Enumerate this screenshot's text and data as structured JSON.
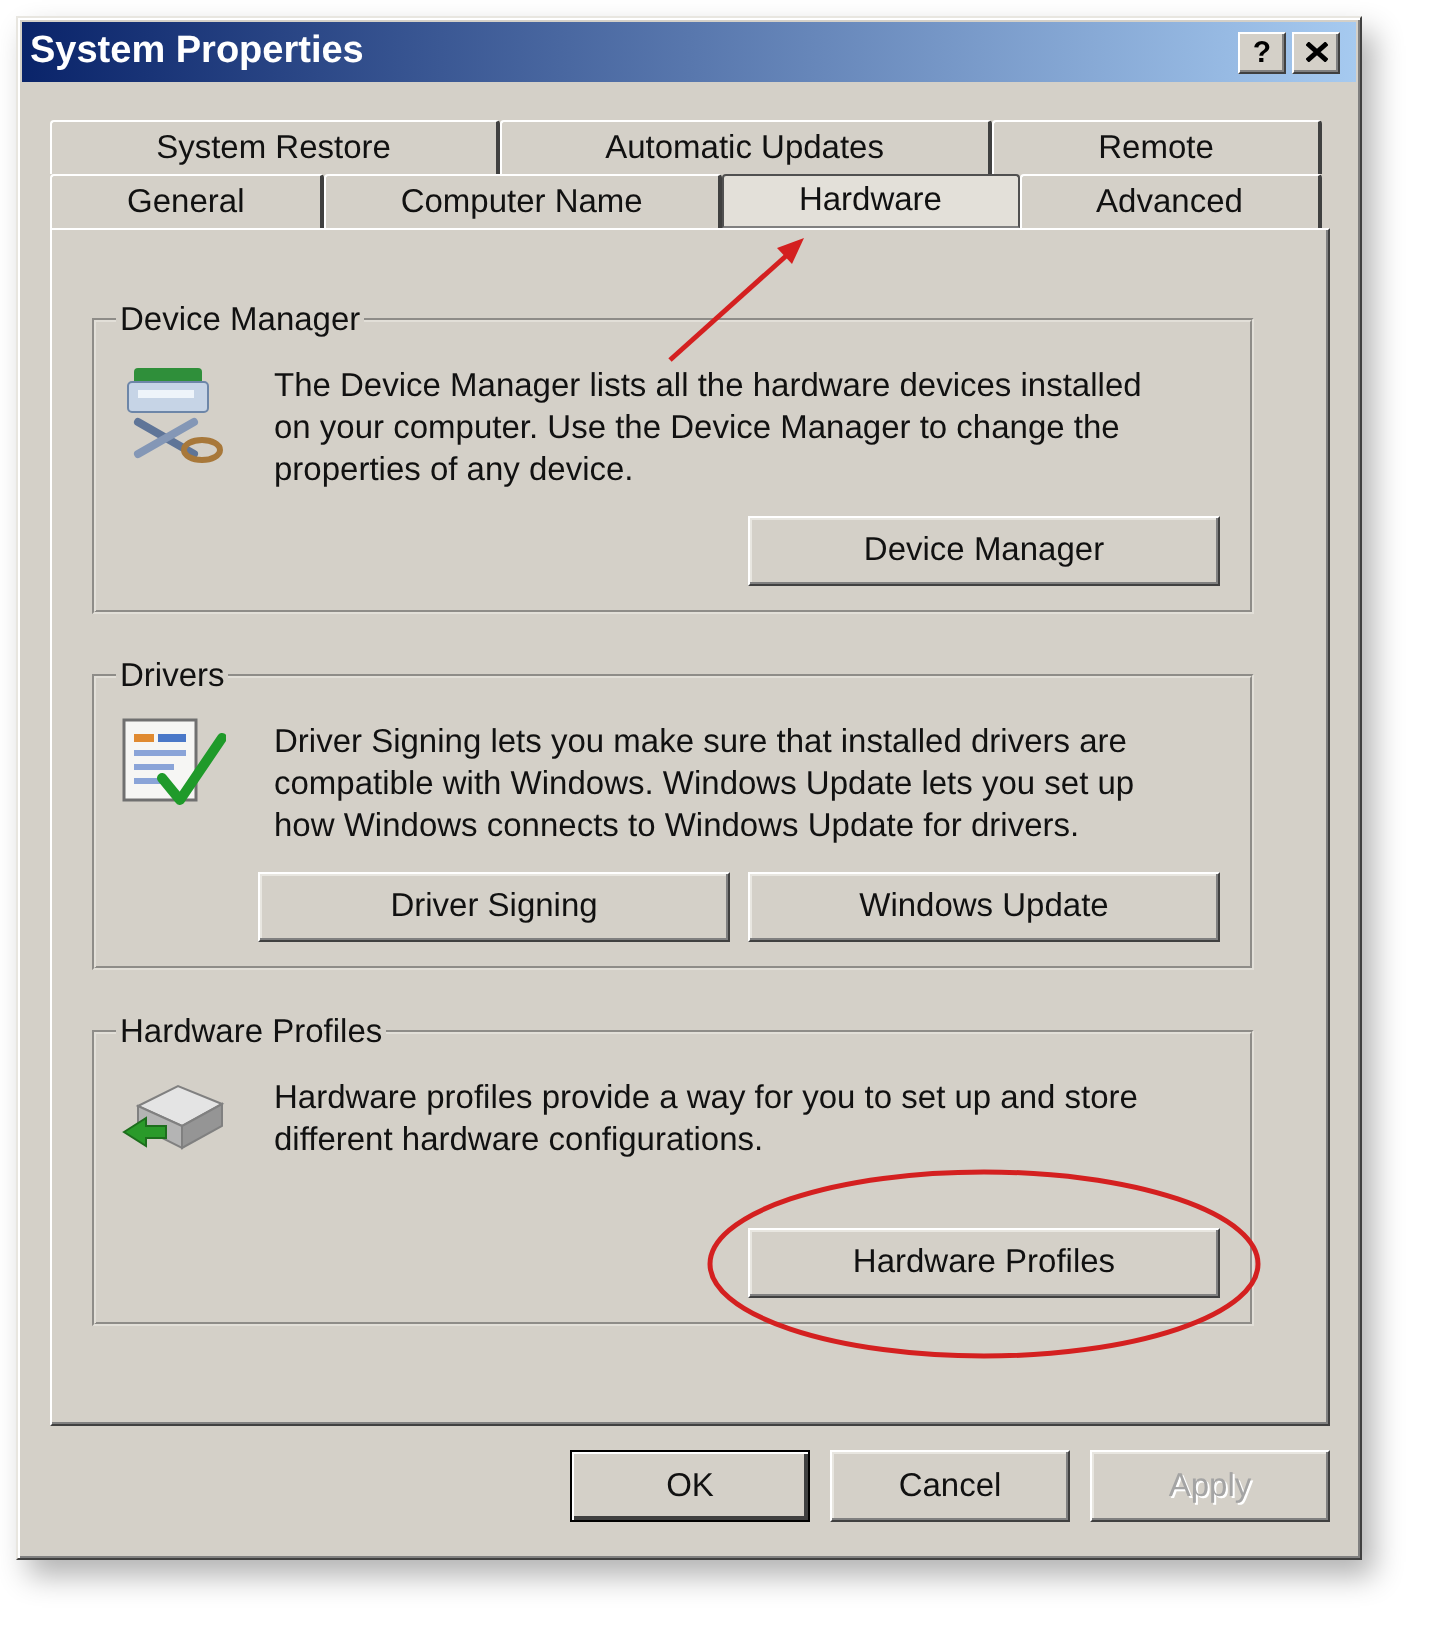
{
  "window": {
    "title": "System Properties",
    "help_button": "?"
  },
  "tab_rows": [
    {
      "tabs": [
        {
          "label": "System Restore",
          "selected": false,
          "arrow": false
        },
        {
          "label": "Automatic Updates",
          "selected": false,
          "arrow": false
        },
        {
          "label": "Remote",
          "selected": false,
          "arrow": false
        }
      ]
    },
    {
      "tabs": [
        {
          "label": "General",
          "selected": false,
          "arrow": false
        },
        {
          "label": "Computer Name",
          "selected": false,
          "arrow": false
        },
        {
          "label": "Hardware",
          "selected": true,
          "arrow": true
        },
        {
          "label": "Advanced",
          "selected": false,
          "arrow": false
        }
      ]
    }
  ],
  "groups": [
    {
      "title": "Device Manager",
      "description": "The Device Manager lists all the hardware devices installed on your computer. Use the Device Manager to change the properties of any device.",
      "buttons": [
        {
          "label": "Device Manager",
          "circled": false
        }
      ]
    },
    {
      "title": "Drivers",
      "description": "Driver Signing lets you make sure that installed drivers are compatible with Windows. Windows Update lets you set up how Windows connects to Windows Update for drivers.",
      "buttons": [
        {
          "label": "Driver Signing",
          "circled": false
        },
        {
          "label": "Windows Update",
          "circled": false
        }
      ]
    },
    {
      "title": "Hardware Profiles",
      "description": "Hardware profiles provide a way for you to set up and store different hardware configurations.",
      "buttons": [
        {
          "label": "Hardware Profiles",
          "circled": true
        }
      ]
    }
  ],
  "dialog_buttons": [
    {
      "label": "OK",
      "default": true,
      "disabled": false
    },
    {
      "label": "Cancel",
      "default": false,
      "disabled": false
    },
    {
      "label": "Apply",
      "default": false,
      "disabled": true
    }
  ]
}
